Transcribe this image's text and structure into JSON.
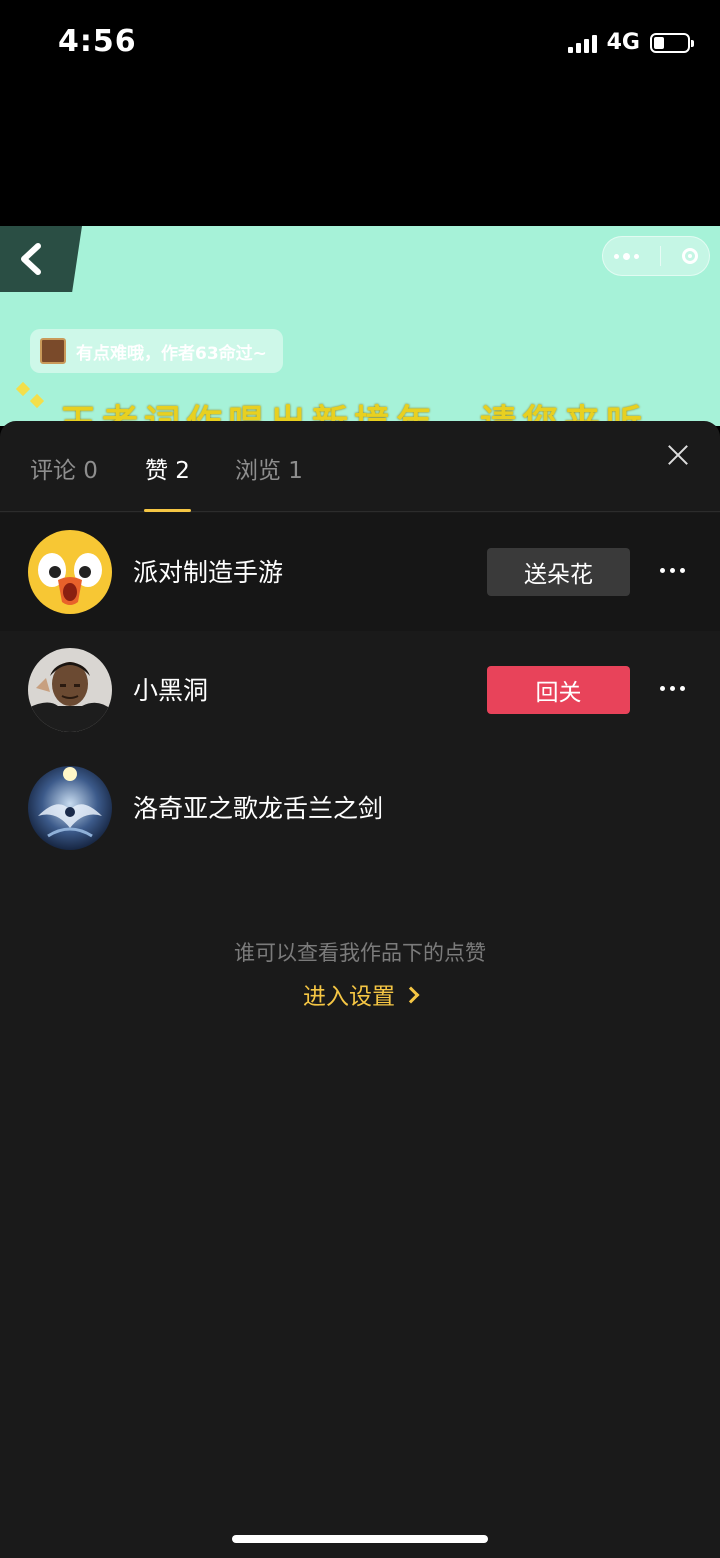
{
  "status_bar": {
    "time": "4:56",
    "network": "4G",
    "battery_level": 0.3
  },
  "background_app": {
    "hint_text": "有点难哦，作者63命过~",
    "banner_text": "王者词作唱出新境年，请您来听"
  },
  "tabs": [
    {
      "label": "评论 0",
      "active": false
    },
    {
      "label": "赞 2",
      "active": true
    },
    {
      "label": "浏览 1",
      "active": false
    }
  ],
  "accent_color": "#f5c644",
  "users": [
    {
      "name": "派对制造手游",
      "action": "送朵花",
      "action_style": "gray",
      "avatar": "duck-avatar"
    },
    {
      "name": "小黑洞",
      "action": "回关",
      "action_style": "red",
      "avatar": "man-avatar"
    },
    {
      "name": "洛奇亚之歌龙舌兰之剑",
      "action": "",
      "avatar": "lugia-avatar"
    }
  ],
  "footer": {
    "privacy_text": "谁可以查看我作品下的点赞",
    "settings_link": "进入设置"
  }
}
